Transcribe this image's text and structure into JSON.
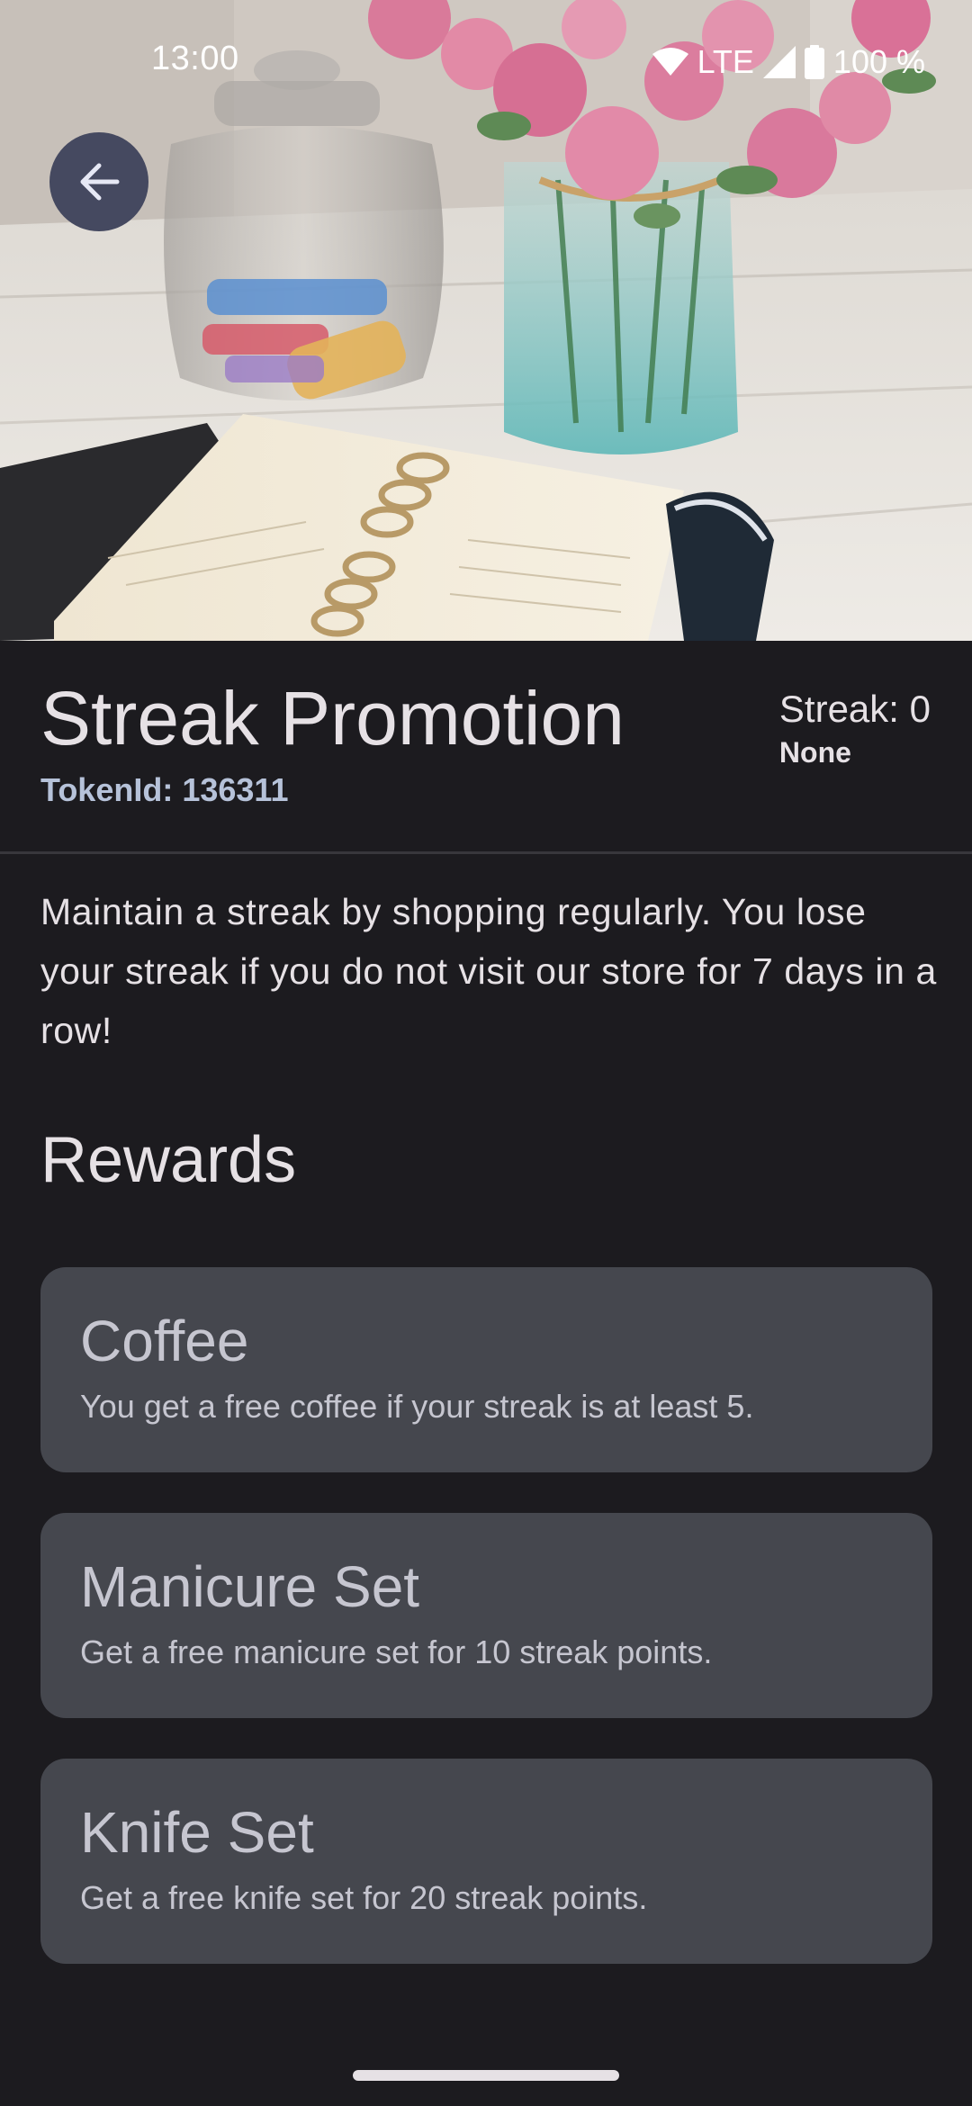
{
  "status_bar": {
    "time": "13:00",
    "network": "LTE",
    "battery": "100 %",
    "icons": [
      "wifi-icon",
      "cell-signal-icon",
      "battery-icon"
    ]
  },
  "hero": {
    "description_icon": "hero-photo"
  },
  "navigation": {
    "back_icon": "arrow-back-icon"
  },
  "header": {
    "title": "Streak Promotion",
    "token_label": "TokenId:",
    "token_value": "136311",
    "streak_label": "Streak:",
    "streak_value": "0",
    "streak_level": "None"
  },
  "description": "Maintain a streak by shopping regularly. You lose your streak if you do not visit our store for 7 days in a row!",
  "rewards": {
    "heading": "Rewards",
    "items": [
      {
        "title": "Coffee",
        "description": "You get a free coffee if your streak is at least 5."
      },
      {
        "title": "Manicure Set",
        "description": "Get a free manicure set for 10 streak points."
      },
      {
        "title": "Knife Set",
        "description": "Get a free knife set for 20 streak points."
      }
    ]
  },
  "colors": {
    "background": "#1c1b1f",
    "card": "#45474e",
    "back_button": "#454960",
    "token_text": "#b6c2d9"
  }
}
